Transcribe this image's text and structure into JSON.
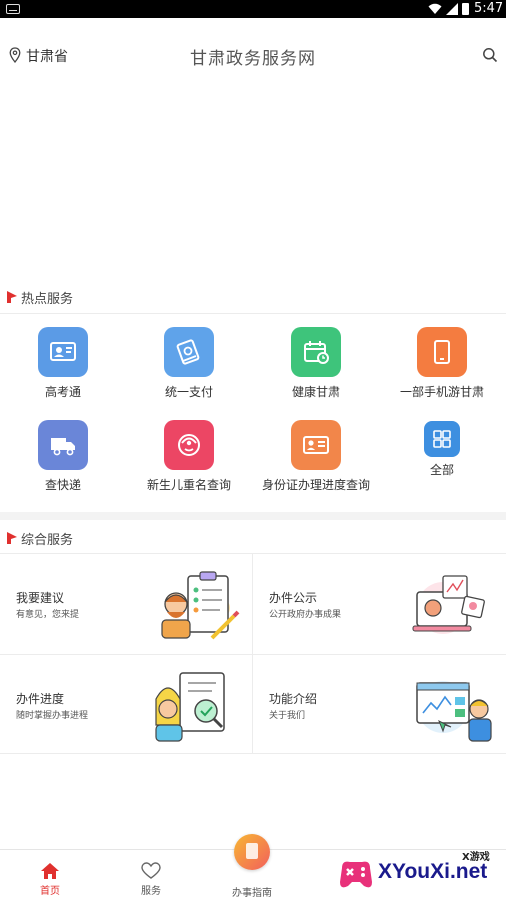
{
  "status_bar": {
    "time": "5:47"
  },
  "header": {
    "location": "甘肃省",
    "title": "甘肃政务服务网"
  },
  "hot_services": {
    "title": "热点服务",
    "items": [
      {
        "label": "高考通",
        "icon": "id-card-icon",
        "color": "#5b9be6"
      },
      {
        "label": "统一支付",
        "icon": "payment-icon",
        "color": "#5fa3ea"
      },
      {
        "label": "健康甘肃",
        "icon": "health-calendar-icon",
        "color": "#3ec47b"
      },
      {
        "label": "一部手机游甘肃",
        "icon": "tablet-icon",
        "color": "#f47c40"
      },
      {
        "label": "查快递",
        "icon": "truck-icon",
        "color": "#6a86d8"
      },
      {
        "label": "新生儿重名查询",
        "icon": "baby-icon",
        "color": "#ec4664"
      },
      {
        "label": "身份证办理进度查询",
        "icon": "id-card-progress-icon",
        "color": "#f2864a"
      },
      {
        "label": "全部",
        "icon": "grid-icon",
        "color": "#3d8fe0"
      }
    ]
  },
  "combined_services": {
    "title": "综合服务",
    "cards": [
      {
        "title": "我要建议",
        "subtitle": "有意见，您来提"
      },
      {
        "title": "办件公示",
        "subtitle": "公开政府办事成果"
      },
      {
        "title": "办件进度",
        "subtitle": "随时掌握办事进程"
      },
      {
        "title": "功能介绍",
        "subtitle": "关于我们"
      }
    ]
  },
  "tabbar": {
    "items": [
      {
        "label": "首页",
        "icon": "home-icon"
      },
      {
        "label": "服务",
        "icon": "heart-icon"
      },
      {
        "label": "办事指南",
        "icon": "guide-icon"
      }
    ]
  },
  "watermark": {
    "small": "X游戏",
    "text": "XYouXi.net"
  },
  "colors": {
    "accent": "#e0302e",
    "flag": "#e0302e"
  }
}
